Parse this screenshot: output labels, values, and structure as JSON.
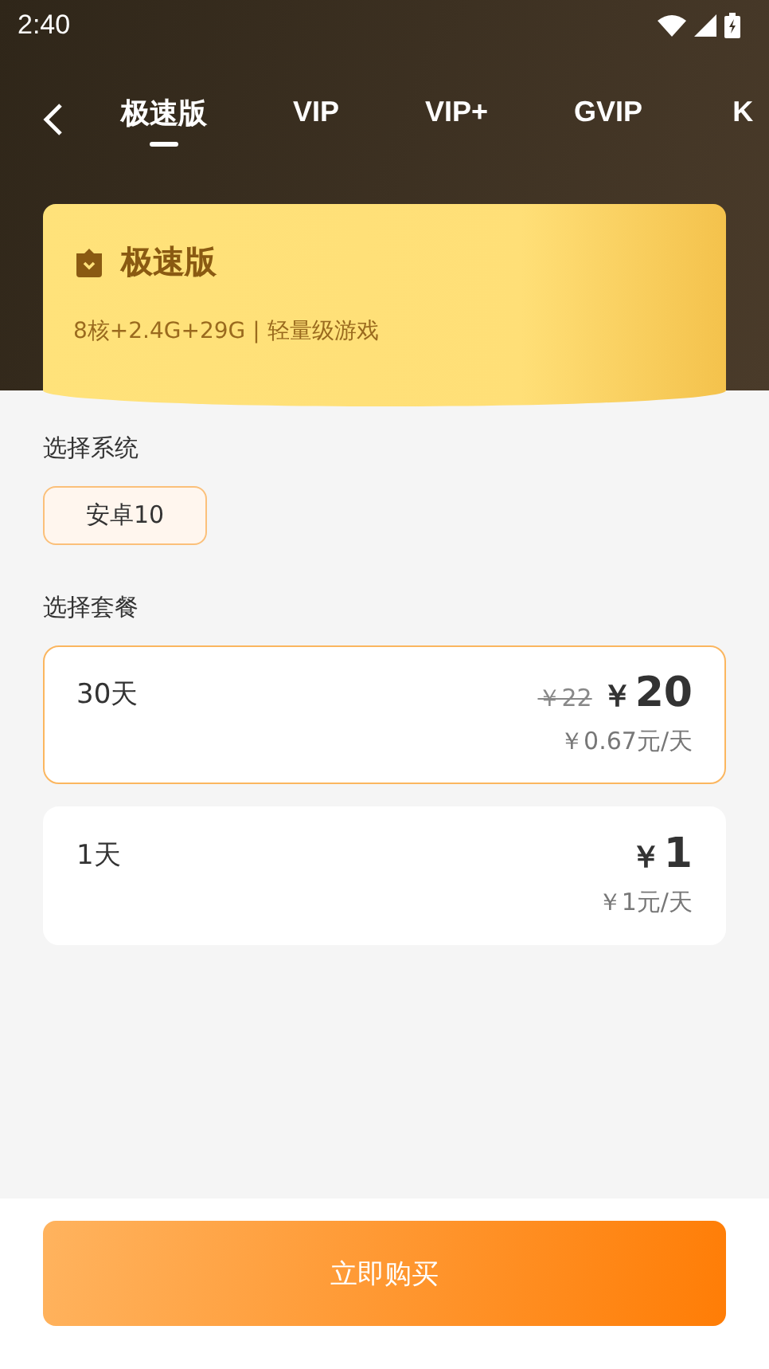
{
  "status_bar": {
    "time": "2:40"
  },
  "tabs": [
    {
      "label": "极速版",
      "selected": true
    },
    {
      "label": "VIP",
      "selected": false
    },
    {
      "label": "VIP+",
      "selected": false
    },
    {
      "label": "GVIP",
      "selected": false
    },
    {
      "label": "K",
      "selected": false
    }
  ],
  "tier_card": {
    "title": "极速版",
    "spec": "8核+2.4G+29G | 轻量级游戏"
  },
  "system_section": {
    "title": "选择系统",
    "options": [
      {
        "label": "安卓10",
        "selected": true
      }
    ]
  },
  "plan_section": {
    "title": "选择套餐",
    "plans": [
      {
        "name": "30天",
        "original_price": "￥22",
        "currency": "￥",
        "price": "20",
        "per_day": "￥0.67元/天",
        "selected": true
      },
      {
        "name": "1天",
        "currency": "￥",
        "price": "1",
        "per_day": "￥1元/天",
        "selected": false
      }
    ]
  },
  "buy_button": {
    "label": "立即购买"
  }
}
